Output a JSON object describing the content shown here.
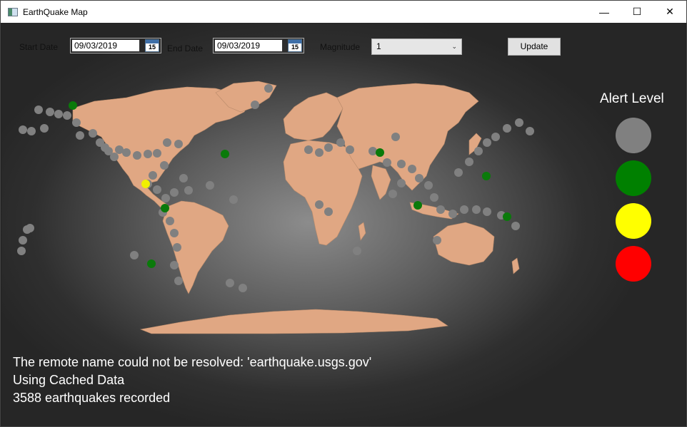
{
  "window": {
    "title": "EarthQuake Map",
    "controls": {
      "minimize": "—",
      "maximize": "☐",
      "close": "✕"
    }
  },
  "toolbar": {
    "start_label": "Start Date",
    "start_value": "09/03/2019",
    "end_label": "End Date",
    "end_value": "09/03/2019",
    "calendar_day": "15",
    "magnitude_label": "Magnitude",
    "magnitude_value": "1",
    "update_label": "Update"
  },
  "map": {
    "land_color": "#e0a783",
    "quake_colors": {
      "gray": "#808080",
      "green": "#0a7a0a",
      "yellow": "#f0f000"
    }
  },
  "legend": {
    "title": "Alert Level",
    "levels": [
      {
        "color": "#808080"
      },
      {
        "color": "#008000"
      },
      {
        "color": "#ffff00"
      },
      {
        "color": "#ff0000"
      }
    ]
  },
  "status": {
    "line1": "The remote name could not be resolved: 'earthquake.usgs.gov'",
    "line2": "Using Cached Data",
    "line3": "3588 earthquakes recorded"
  }
}
